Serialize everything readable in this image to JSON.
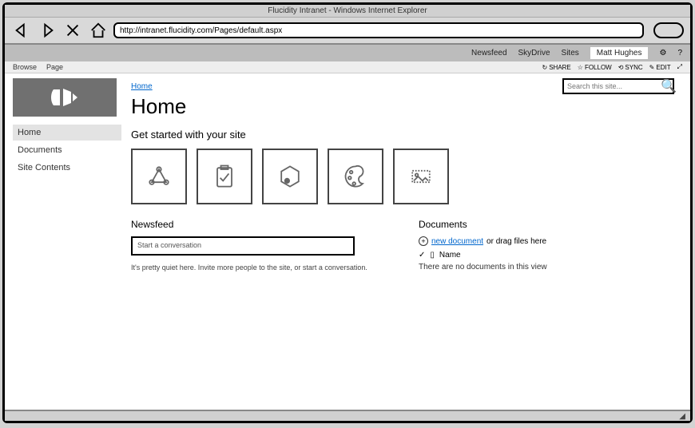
{
  "browser": {
    "title": "Flucidity Intranet - Windows Internet Explorer",
    "url": "http://intranet.flucidity.com/Pages/default.aspx"
  },
  "suiteBar": {
    "links": [
      "Newsfeed",
      "SkyDrive",
      "Sites"
    ],
    "user": "Matt Hughes"
  },
  "ribbon": {
    "tabs": [
      "Browse",
      "Page"
    ],
    "actions": [
      "SHARE",
      "FOLLOW",
      "SYNC",
      "EDIT"
    ]
  },
  "search": {
    "placeholder": "Search this site..."
  },
  "nav": {
    "items": [
      "Home",
      "Documents",
      "Site Contents"
    ],
    "activeIndex": 0
  },
  "breadcrumb": "Home",
  "pageTitle": "Home",
  "getStarted": {
    "heading": "Get started with your site",
    "tiles": [
      "share-tile",
      "clipboard-tile",
      "hexagon-tile",
      "palette-tile",
      "image-tile"
    ]
  },
  "newsfeed": {
    "heading": "Newsfeed",
    "placeholder": "Start a conversation",
    "emptyHint": "It's pretty quiet here. Invite more people to the site, or start a conversation."
  },
  "documents": {
    "heading": "Documents",
    "newLink": "new document",
    "dragText": " or drag files here",
    "nameCol": "Name",
    "emptyMsg": "There are no documents in this view"
  }
}
